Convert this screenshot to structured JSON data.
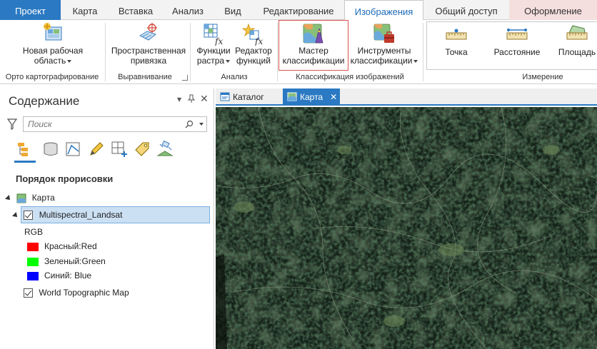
{
  "ribbon_tabs": [
    {
      "label": "Проект"
    },
    {
      "label": "Карта"
    },
    {
      "label": "Вставка"
    },
    {
      "label": "Анализ"
    },
    {
      "label": "Вид"
    },
    {
      "label": "Редактирование"
    },
    {
      "label": "Изображения"
    },
    {
      "label": "Общий доступ"
    },
    {
      "label": "Оформление"
    }
  ],
  "ribbon": {
    "new_workspace": {
      "line1": "Новая рабочая",
      "line2": "область"
    },
    "spatial_reference": {
      "line1": "Пространственная",
      "line2": "привязка"
    },
    "raster_functions": {
      "line1": "Функции",
      "line2": "растра"
    },
    "function_editor": {
      "line1": "Редактор",
      "line2": "функций"
    },
    "classification_wizard": {
      "line1": "Мастер",
      "line2": "классификации"
    },
    "classification_tools": {
      "line1": "Инструменты",
      "line2": "классификации"
    },
    "point": {
      "label": "Точка"
    },
    "distance": {
      "label": "Расстояние"
    },
    "area": {
      "label": "Площадь"
    },
    "groups": {
      "ortho": "Орто картографирование",
      "alignment": "Выравнивание",
      "analysis": "Анализ",
      "image_classification": "Классификация изображений",
      "measurement": "Измерение"
    }
  },
  "contents": {
    "title": "Содержание",
    "search_placeholder": "Поиск",
    "drawing_order": "Порядок прорисовки",
    "map_item": "Карта",
    "layer_name": "Multispectral_Landsat",
    "renderer": "RGB",
    "bands": [
      {
        "label": "Красный:Red",
        "color": "#ff0000"
      },
      {
        "label": "Зеленый:Green",
        "color": "#00ff00"
      },
      {
        "label": "Синий: Blue",
        "color": "#0000ff"
      }
    ],
    "basemap": "World Topographic Map"
  },
  "view_tabs": [
    {
      "label": "Каталог"
    },
    {
      "label": "Карта"
    }
  ],
  "colors": {
    "accent": "#2b79c2",
    "highlight": "#d9534f",
    "format_tab": "#f5dede",
    "map_dark": "#17251a"
  }
}
